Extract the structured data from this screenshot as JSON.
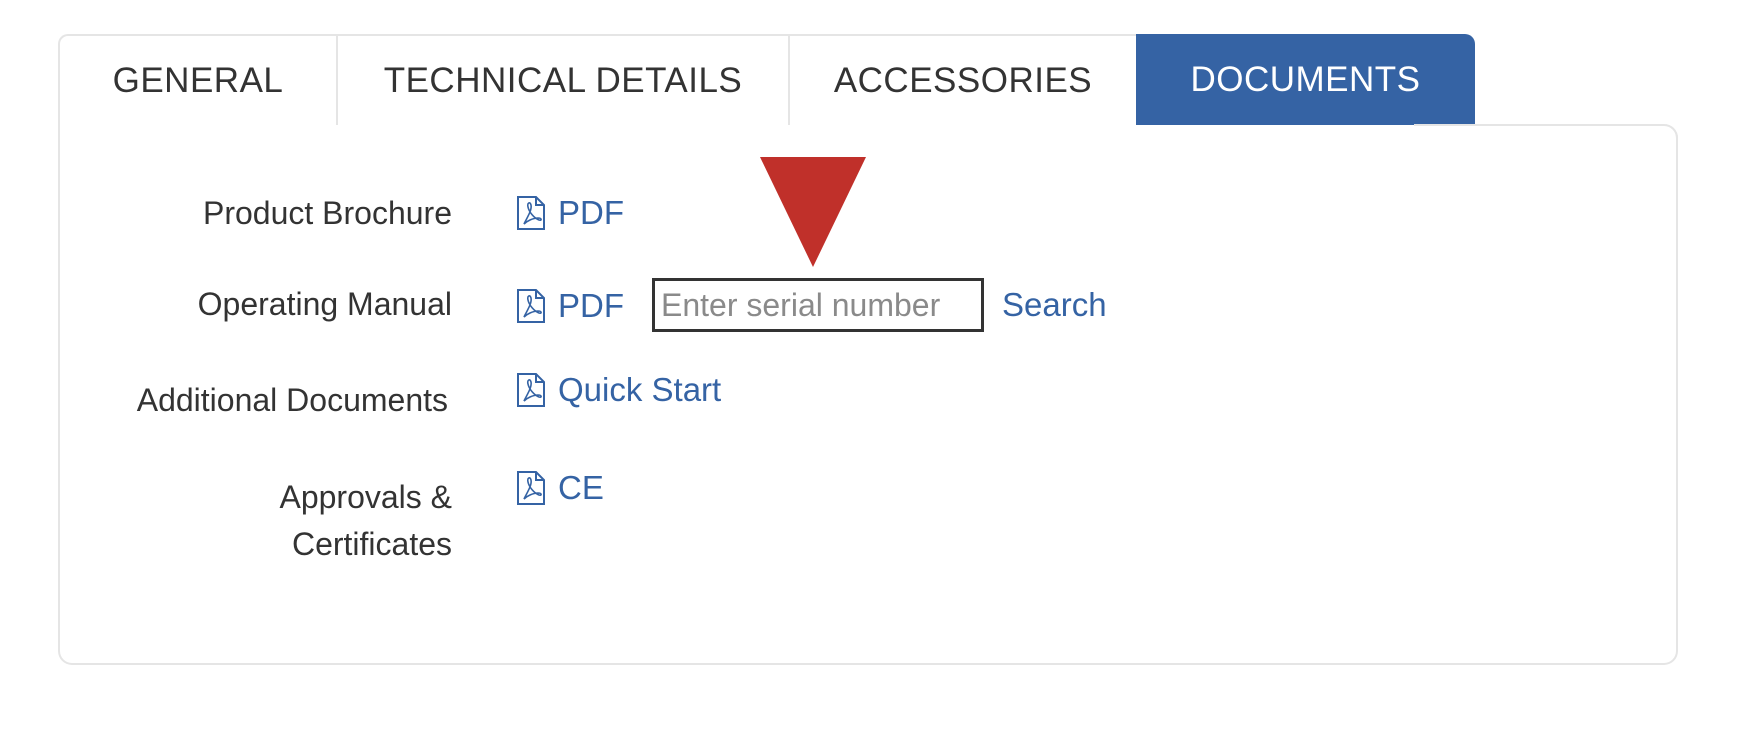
{
  "tabs": [
    {
      "label": "GENERAL",
      "active": false
    },
    {
      "label": "TECHNICAL DETAILS",
      "active": false
    },
    {
      "label": "ACCESSORIES",
      "active": false
    },
    {
      "label": "DOCUMENTS",
      "active": true
    }
  ],
  "documents": {
    "product_brochure": {
      "label": "Product Brochure",
      "link": "PDF"
    },
    "operating_manual": {
      "label": "Operating Manual",
      "link": "PDF",
      "serial_placeholder": "Enter serial number",
      "serial_value": "",
      "search_label": "Search"
    },
    "additional_documents": {
      "label": "Additional Documents",
      "link": "Quick Start"
    },
    "approvals": {
      "label_line1": "Approvals &",
      "label_line2": "Certificates",
      "link": "CE"
    }
  },
  "icons": {
    "document": "pdf-file-icon",
    "marker": "red-down-arrow-icon"
  },
  "colors": {
    "accent": "#3563a4",
    "marker": "#c0302a",
    "border": "#e5e5e5",
    "text": "#333333"
  }
}
